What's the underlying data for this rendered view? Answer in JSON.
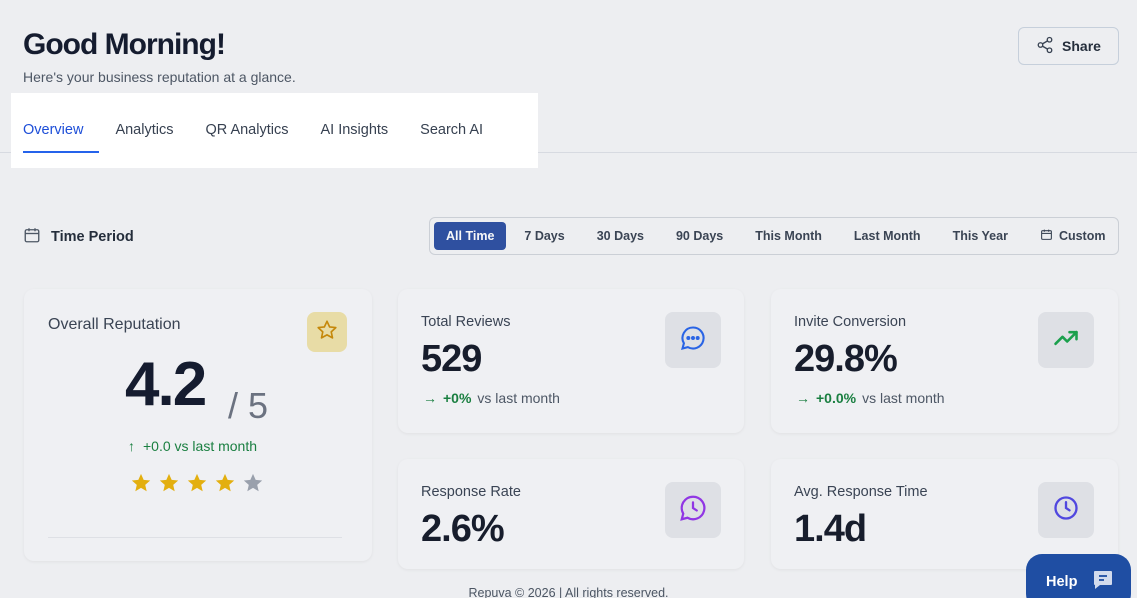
{
  "header": {
    "greeting": "Good Morning!",
    "subtitle": "Here's your business reputation at a glance.",
    "share_label": "Share"
  },
  "tabs": [
    {
      "label": "Overview",
      "active": true
    },
    {
      "label": "Analytics",
      "active": false
    },
    {
      "label": "QR Analytics",
      "active": false
    },
    {
      "label": "AI Insights",
      "active": false
    },
    {
      "label": "Search AI",
      "active": false
    }
  ],
  "time_period": {
    "label": "Time Period",
    "options": [
      "All Time",
      "7 Days",
      "30 Days",
      "90 Days",
      "This Month",
      "Last Month",
      "This Year",
      "Custom"
    ],
    "selected": "All Time"
  },
  "reputation": {
    "title": "Overall Reputation",
    "score": "4.2",
    "out_of": "/ 5",
    "delta": "+0.0 vs last month",
    "rating": 4,
    "max_rating": 5
  },
  "metrics": {
    "total_reviews": {
      "title": "Total Reviews",
      "value": "529",
      "delta": "+0%",
      "delta_suffix": "vs last month"
    },
    "invite_conversion": {
      "title": "Invite Conversion",
      "value": "29.8%",
      "delta": "+0.0%",
      "delta_suffix": "vs last month"
    },
    "response_rate": {
      "title": "Response Rate",
      "value": "2.6%"
    },
    "avg_response_time": {
      "title": "Avg. Response Time",
      "value": "1.4d"
    }
  },
  "footer": {
    "text": "Repuva © 2026 | All rights reserved."
  },
  "help": {
    "label": "Help"
  },
  "colors": {
    "accent": "#2563eb",
    "selected_period": "#2b4ea2",
    "positive": "#15803d",
    "star": "#eab308",
    "help_button": "#1f4ea3"
  }
}
